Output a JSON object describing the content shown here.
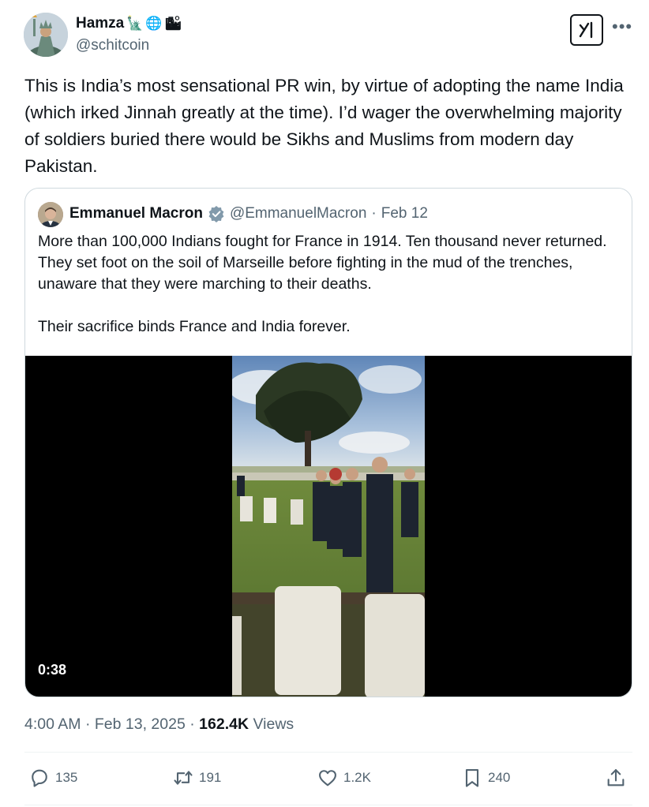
{
  "author": {
    "display_name": "Hamza",
    "name_emojis": [
      "🗽",
      "🌐",
      "🏙"
    ],
    "handle": "@schitcoin"
  },
  "header_actions": {
    "grok_icon": "grok-icon",
    "more_icon": "more-icon"
  },
  "tweet": {
    "text": "This is India’s most sensational PR win, by virtue of adopting the name India (which irked Jinnah greatly at the time). I’d wager the overwhelming majority of soldiers buried there would be Sikhs and Muslims from modern day Pakistan."
  },
  "quoted_tweet": {
    "display_name": "Emmanuel Macron",
    "handle": "@EmmanuelMacron",
    "separator": "·",
    "date": "Feb 12",
    "paragraph_1": "More than 100,000 Indians fought for France in 1914. Ten thousand never returned. They set foot on the soil of Marseille before fighting in the mud of the trenches, unaware that they were marching to their deaths.",
    "paragraph_2": "Their sacrifice binds France and India forever.",
    "video_duration": "0:38"
  },
  "meta": {
    "time": "4:00 AM",
    "separator_1": "·",
    "date": "Feb 13, 2025",
    "separator_2": "·",
    "views_count": "162.4K",
    "views_label": "Views"
  },
  "actions": {
    "replies": "135",
    "reposts": "191",
    "likes": "1.2K",
    "bookmarks": "240"
  },
  "colors": {
    "text_primary": "#0f1419",
    "text_secondary": "#536471",
    "border": "#cfd9de",
    "verified": "#829aab"
  }
}
